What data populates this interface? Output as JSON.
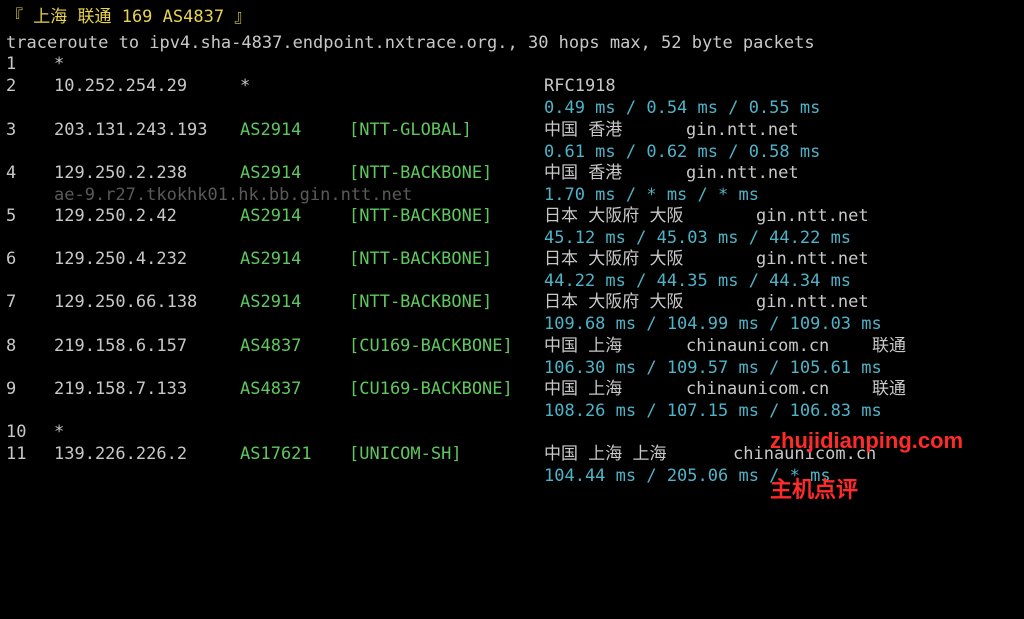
{
  "header": {
    "title": "『 上海 联通 169 AS4837 』",
    "command": "traceroute to ipv4.sha-4837.endpoint.nxtrace.org., 30 hops max, 52 byte packets"
  },
  "hops": [
    {
      "hop": "1",
      "ip": "*"
    },
    {
      "hop": "2",
      "ip": "10.252.254.29",
      "asn": "*",
      "geo": "RFC1918",
      "rtt": "0.49 ms / 0.54 ms / 0.55 ms"
    },
    {
      "hop": "3",
      "ip": "203.131.243.193",
      "asn": "AS2914",
      "tag": "[NTT-GLOBAL]",
      "geo": "中国 香港",
      "domain": "gin.ntt.net",
      "rtt": "0.61 ms / 0.62 ms / 0.58 ms"
    },
    {
      "hop": "4",
      "ip": "129.250.2.238",
      "asn": "AS2914",
      "tag": "[NTT-BACKBONE]",
      "geo": "中国 香港",
      "domain": "gin.ntt.net",
      "ptr": "ae-9.r27.tkokhk01.hk.bb.gin.ntt.net",
      "rtt": "1.70 ms / * ms / * ms"
    },
    {
      "hop": "5",
      "ip": "129.250.2.42",
      "asn": "AS2914",
      "tag": "[NTT-BACKBONE]",
      "geo": "日本 大阪府 大阪",
      "domain": "gin.ntt.net",
      "rtt": "45.12 ms / 45.03 ms / 44.22 ms"
    },
    {
      "hop": "6",
      "ip": "129.250.4.232",
      "asn": "AS2914",
      "tag": "[NTT-BACKBONE]",
      "geo": "日本 大阪府 大阪",
      "domain": "gin.ntt.net",
      "rtt": "44.22 ms / 44.35 ms / 44.34 ms"
    },
    {
      "hop": "7",
      "ip": "129.250.66.138",
      "asn": "AS2914",
      "tag": "[NTT-BACKBONE]",
      "geo": "日本 大阪府 大阪",
      "domain": "gin.ntt.net",
      "rtt": "109.68 ms / 104.99 ms / 109.03 ms"
    },
    {
      "hop": "8",
      "ip": "219.158.6.157",
      "asn": "AS4837",
      "tag": "[CU169-BACKBONE]",
      "geo": "中国 上海",
      "domain": "chinaunicom.cn",
      "isp": "联通",
      "rtt": "106.30 ms / 109.57 ms / 105.61 ms"
    },
    {
      "hop": "9",
      "ip": "219.158.7.133",
      "asn": "AS4837",
      "tag": "[CU169-BACKBONE]",
      "geo": "中国 上海",
      "domain": "chinaunicom.cn",
      "isp": "联通",
      "rtt": "108.26 ms / 107.15 ms / 106.83 ms"
    },
    {
      "hop": "10",
      "ip": "*"
    },
    {
      "hop": "11",
      "ip": "139.226.226.2",
      "asn": "AS17621",
      "tag": "[UNICOM-SH]",
      "geo": "中国 上海 上海",
      "domain": "chinaunicom.cn",
      "rtt": "104.44 ms / 205.06 ms / * ms"
    }
  ],
  "watermark": {
    "domain": "zhujidianping.com",
    "name": "主机点评"
  },
  "colors": {
    "background": "#000000",
    "title": "#e8d44d",
    "asn": "#5ec85e",
    "rtt": "#4fb3c8",
    "text": "#c8c8c8",
    "ptr": "#5a5a5a",
    "watermark": "#ff2a2a"
  }
}
